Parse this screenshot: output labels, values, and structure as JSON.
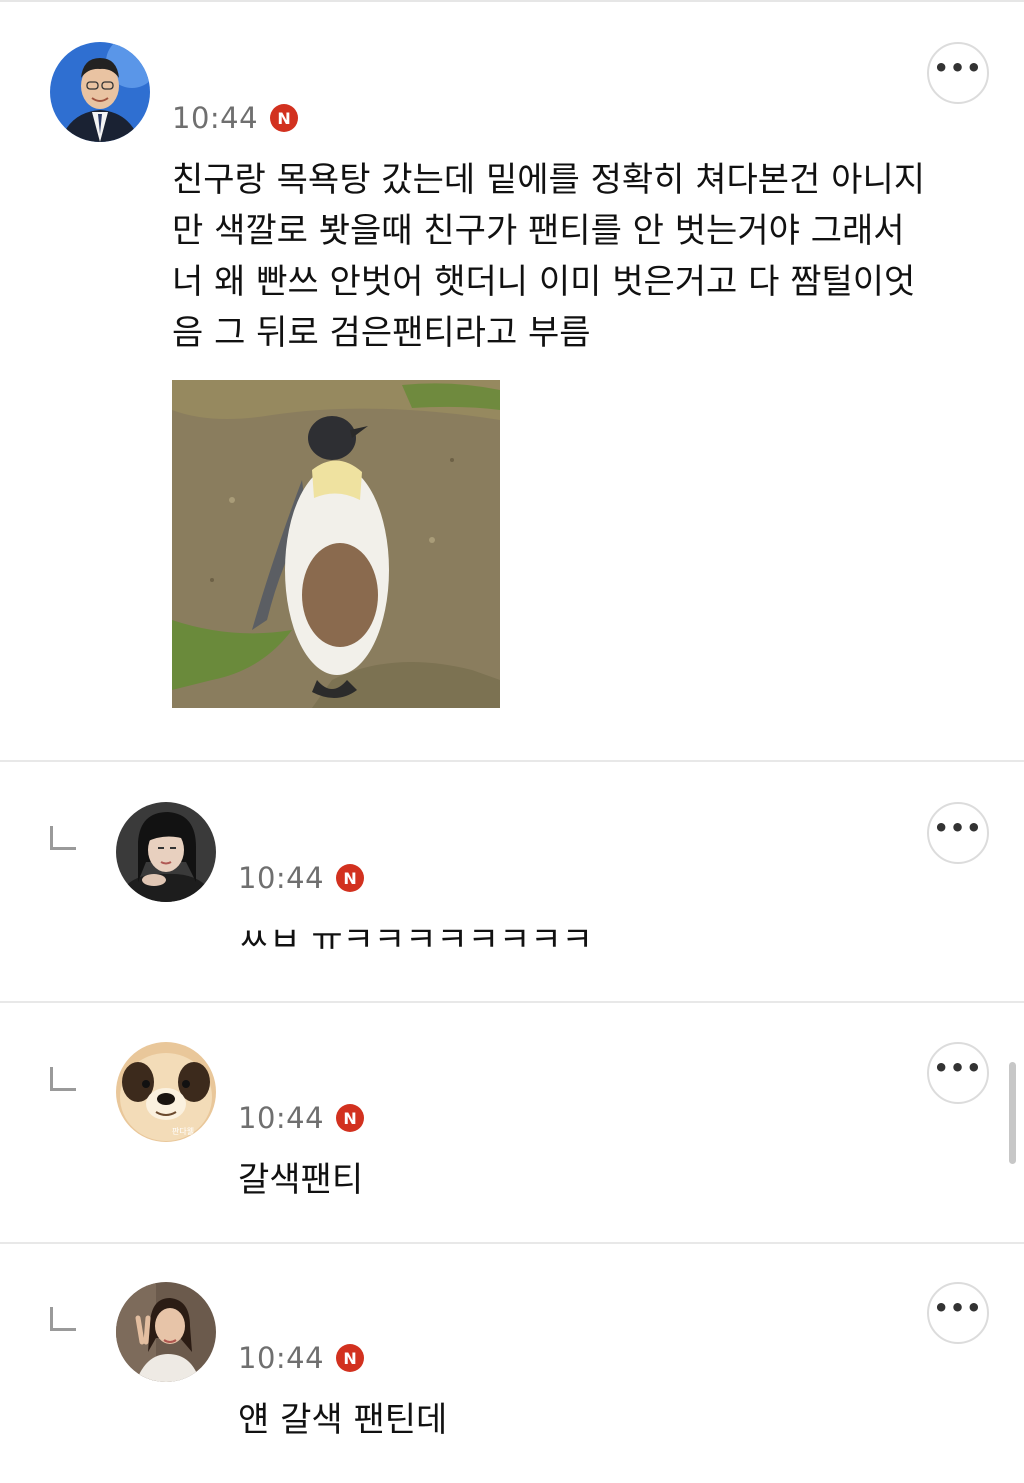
{
  "comments": [
    {
      "avatar": "user-avatar-man-in-suit",
      "time": "10:44",
      "badge": "N",
      "text": "친구랑 목욕탕 갔는데 밑에를 정확히 쳐다본건 아니지\n만 색깔로 봣을때 친구가 팬티를 안 벗는거야 그래서\n너 왜 빤쓰 안벗어 햇더니 이미 벗은거고 다 짬털이엇\n음 그 뒤로 검은팬티라고 부름",
      "image": "penguin-photo"
    },
    {
      "avatar": "user-avatar-woman-dark-hair",
      "time": "10:44",
      "badge": "N",
      "text": "ㅆㅂ ㅠㅋㅋㅋㅋㅋㅋㅋㅋ"
    },
    {
      "avatar": "user-avatar-puppy",
      "avatar_caption": "판다웰",
      "time": "10:44",
      "badge": "N",
      "text": "갈색팬티"
    },
    {
      "avatar": "user-avatar-woman-v-sign",
      "time": "10:44",
      "badge": "N",
      "text": "얜 갈색 팬틴데"
    }
  ],
  "more_icon": "more-dots-icon",
  "reply_icon": "reply-arrow-icon",
  "colors": {
    "badge": "#d2311f",
    "time": "#6f6f6f",
    "divider": "#e8e8e8"
  }
}
